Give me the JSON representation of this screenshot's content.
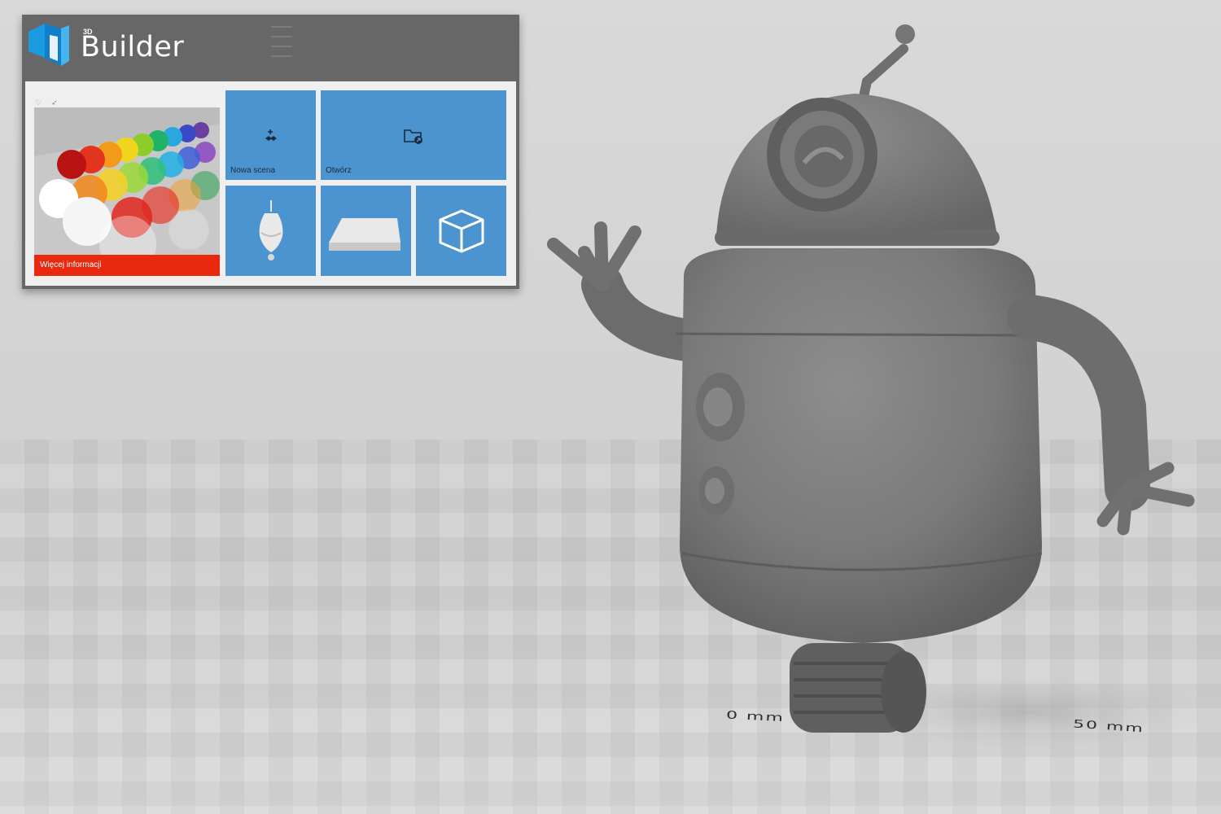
{
  "app": {
    "title": "Builder",
    "title_superscript": "3D"
  },
  "start_panel": {
    "promo": {
      "label": "Więcej informacji",
      "accent_color": "#e8290f"
    },
    "tiles": [
      {
        "label": "Nowa scena",
        "icon": "new-scene-icon",
        "color": "#4b94d0"
      },
      {
        "label": "Otwórz",
        "icon": "folder-open-icon",
        "color": "#4b94d0"
      },
      {
        "label": "",
        "icon": "lightbulb-model-thumbnail"
      },
      {
        "label": "",
        "icon": "plate-model-thumbnail"
      },
      {
        "label": "",
        "icon": "cube-icon"
      }
    ]
  },
  "viewport": {
    "ruler_start": "0 mm",
    "ruler_end": "50 mm",
    "model": "robot"
  }
}
